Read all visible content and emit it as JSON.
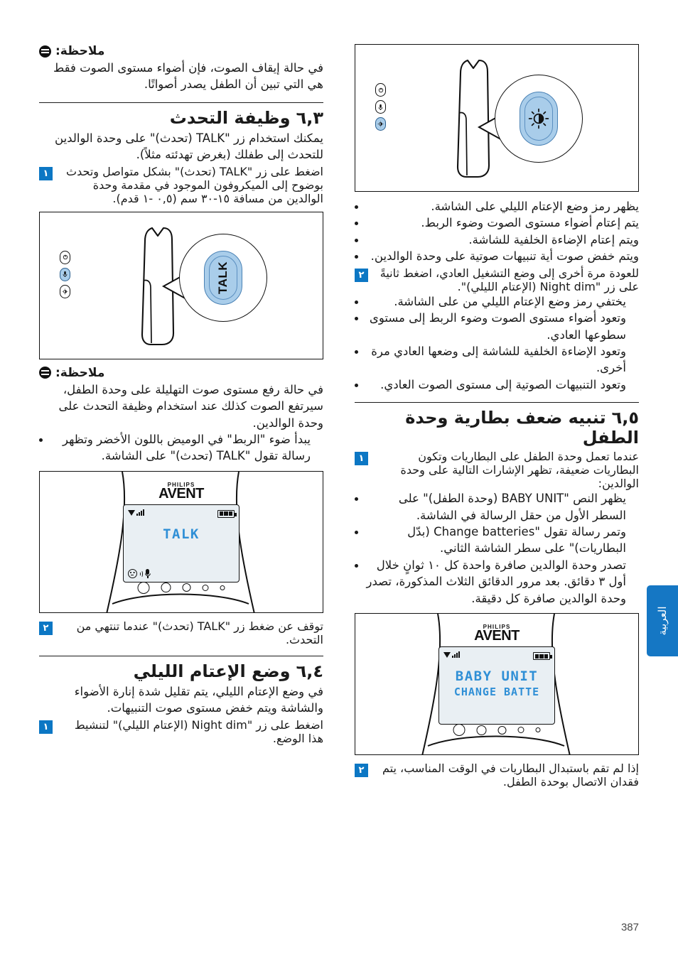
{
  "page": {
    "number": "387",
    "side_tab_label": "العربية",
    "accent_color": "#0c77c4",
    "tab_color": "#1577c4",
    "lcd_text_color": "#2f8fd6",
    "key_highlight_color": "#a9cdea"
  },
  "right_column": {
    "note_1": {
      "icon": "note-icon",
      "heading": "ملاحظة:",
      "text": "في حالة إيقاف الصوت، فإن أضواء مستوى الصوت فقط هي التي تبين أن الطفل يصدر أصواتًا."
    },
    "section_talk": {
      "number": "٦,٣",
      "title": "وظيفة التحدث",
      "intro": "يمكنك استخدام زر \"TALK (تحدث)\" على وحدة الوالدين للتحدث إلى طفلك (بغرض تهدئته مثلاً).",
      "step_1": {
        "badge": "١",
        "text": "اضغط على زر \"TALK (تحدث)\" بشكل متواصل وتحدث بوضوح إلى الميكروفون الموجود في مقدمة وحدة الوالدين من مسافة ١٥-٣٠ سم (٠,٥ -١ قدم)."
      },
      "figure_device": {
        "caption_key": "TALK",
        "buttons": [
          "power-button",
          "talk-button",
          "night-dim-button"
        ],
        "highlighted_button_index": 1
      },
      "note_2": {
        "heading": "ملاحظة:",
        "text": "في حالة رفع مستوى صوت التهليلة على وحدة الطفل، سيرتفع الصوت كذلك عند استخدام وظيفة التحدث على وحدة الوالدين.",
        "bullet": "يبدأ ضوء \"الربط\" في الوميض باللون الأخضر وتظهر رسالة تقول \"TALK (تحدث)\" على الشاشة."
      },
      "figure_screen": {
        "brand_top": "PHILIPS",
        "brand_main": "AVENT",
        "lcd_line_1": "TALK",
        "lcd_line_2": "",
        "signal_icon": "signal-bars-icon",
        "battery_icon": "battery-full-icon",
        "status_icons": [
          "face-sound-icon",
          "microphone-icon"
        ],
        "button_count": 5
      },
      "step_2": {
        "badge": "٢",
        "text": "توقف عن ضغط زر \"TALK (تحدث)\" عندما تنتهي من التحدث."
      }
    },
    "section_night_dim": {
      "number": "٦,٤",
      "title": "وضع الإعتام الليلي",
      "intro": "في وضع الإعتام الليلي، يتم تقليل شدة إنارة الأضواء والشاشة ويتم خفض مستوى صوت التنبيهات.",
      "step_1": {
        "badge": "١",
        "text": "اضغط على زر \"Night dim (الإعتام الليلي)\" لتنشيط هذا الوضع."
      }
    }
  },
  "left_column": {
    "figure_device": {
      "caption_key": "night-dim",
      "buttons": [
        "power-button",
        "talk-button",
        "night-dim-button"
      ],
      "highlighted_button_index": 2
    },
    "bullets_activate": [
      "يظهر رمز وضع الإعتام الليلي على الشاشة.",
      "يتم إعتام أضواء مستوى الصوت وضوء الربط.",
      "ويتم إعتام الإضاءة الخلفية للشاشة.",
      "ويتم خفض صوت أية تنبيهات صوتية على وحدة الوالدين."
    ],
    "step_2": {
      "badge": "٢",
      "text": "للعودة مرة أخرى إلى وضع التشغيل العادي، اضغط ثانيةً على زر \"Night dim (الإعتام الليلي)\"."
    },
    "bullets_deactivate": [
      "يختفي رمز وضع الإعتام الليلي من على الشاشة.",
      "وتعود أضواء مستوى الصوت وضوء الربط إلى مستوى سطوعها العادي.",
      "وتعود الإضاءة الخلفية للشاشة إلى وضعها العادي مرة أخرى.",
      "وتعود التنبيهات الصوتية إلى مستوى الصوت العادي."
    ],
    "section_battery": {
      "number": "٦,٥",
      "title": "تنبيه ضعف بطارية وحدة الطفل",
      "step_1": {
        "badge": "١",
        "text": "عندما تعمل وحدة الطفل على البطاريات وتكون البطاريات ضعيفة، تظهر الإشارات التالية على وحدة الوالدين:"
      },
      "bullets": [
        "يظهر النص \"BABY UNIT (وحدة الطفل)\" على السطر الأول من حقل الرسالة في الشاشة.",
        "وتمر رسالة تقول \"Change batteries (بدّل البطاريات)\" على سطر الشاشة الثاني.",
        "تصدر وحدة الوالدين صافرة واحدة كل ١٠ ثوانٍ خلال أول ٣ دقائق. بعد مرور الدقائق الثلاث المذكورة، تصدر وحدة الوالدين صافرة كل دقيقة."
      ],
      "figure_screen": {
        "brand_top": "PHILIPS",
        "brand_main": "AVENT",
        "lcd_line_1": "BABY UNIT",
        "lcd_line_2": "CHANGE BATTE",
        "signal_icon": "signal-bars-icon",
        "battery_icon": "battery-full-icon",
        "button_count": 5
      },
      "step_2": {
        "badge": "٢",
        "text": "إذا لم تقم باستبدال البطاريات في الوقت المناسب، يتم فقدان الاتصال بوحدة الطفل."
      }
    }
  }
}
